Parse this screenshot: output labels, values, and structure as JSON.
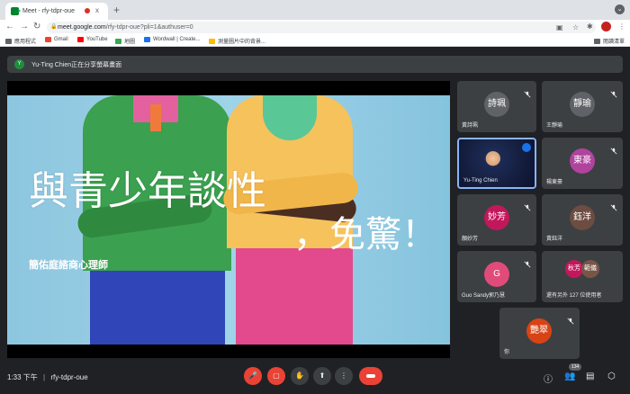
{
  "browser": {
    "tab_title": "Meet - rfy-tdpr-oue",
    "tab_close": "x",
    "new_tab": "+",
    "url_host": "meet.google.com",
    "url_path": "/rfy-tdpr-oue?pli=1&authuser=0",
    "reading_list": "閱讀清單"
  },
  "bookmarks": [
    {
      "label": "應用程式",
      "color": "#5f6368"
    },
    {
      "label": "Gmail",
      "color": "#ea4335"
    },
    {
      "label": "YouTube",
      "color": "#ff0000"
    },
    {
      "label": "地圖",
      "color": "#34a853"
    },
    {
      "label": "Wordwall | Create...",
      "color": "#1a73e8"
    },
    {
      "label": "測量圖片中的背景...",
      "color": "#fbbc04"
    }
  ],
  "banner": {
    "initial": "Y",
    "text": "Yu-Ting Chien正在分享螢幕畫面"
  },
  "slide": {
    "title": "與青少年談性",
    "subtitle": "，免驚！",
    "author": "簡佑庭諮商心理師"
  },
  "participants": [
    {
      "avatar": "詩珮",
      "name": "黃詩珮",
      "color": "#5f6368",
      "muted": true
    },
    {
      "avatar": "靜瑜",
      "name": "王靜瑜",
      "color": "#5f6368",
      "muted": true
    },
    {
      "avatar": "",
      "name": "Yu-Ting Chien",
      "color": "",
      "muted": false,
      "speaking": true
    },
    {
      "avatar": "東豪",
      "name": "楊東豪",
      "color": "#b0439e",
      "muted": true
    },
    {
      "avatar": "妙芳",
      "name": "顏妙芳",
      "color": "#c2185b",
      "muted": true
    },
    {
      "avatar": "鈺洋",
      "name": "黃鈺洋",
      "color": "#6d4c41",
      "muted": true
    },
    {
      "avatar": "G",
      "name": "Guo Sandy郭乃慧",
      "color": "#e04b7a",
      "muted": true
    },
    {
      "avatar": "秋芳",
      "avatar2": "範儀",
      "name": "還有另外 127 位使用者",
      "color": "#c2185b",
      "color2": "#795548",
      "muted": false
    },
    {
      "avatar": "艷翠",
      "name": "你",
      "color": "#d84315",
      "muted": true
    }
  ],
  "bottom": {
    "time": "1:33 下午",
    "separator": "|",
    "meeting_code": "rfy-tdpr-oue",
    "people_count": "134"
  }
}
